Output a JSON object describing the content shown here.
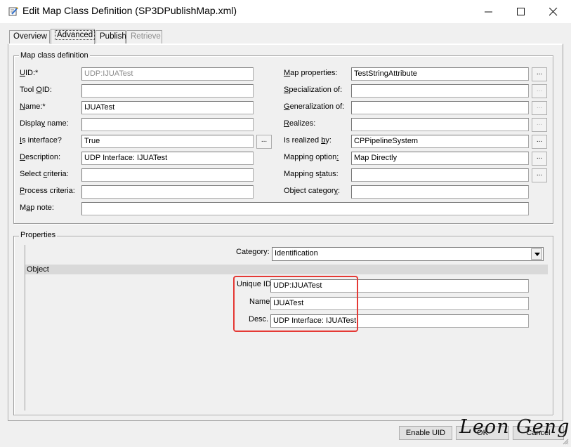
{
  "window": {
    "title": "Edit Map Class Definition (SP3DPublishMap.xml)",
    "minimize": "—",
    "maximize": "☐",
    "close": "✕"
  },
  "tabs": [
    {
      "label": "Overview",
      "state": "normal"
    },
    {
      "label": "Advanced",
      "state": "active"
    },
    {
      "label": "Publish",
      "state": "normal"
    },
    {
      "label": "Retrieve",
      "state": "disabled"
    }
  ],
  "map_class": {
    "group_title": "Map class definition",
    "uid": {
      "label": "UID:*",
      "value": "UDP:IJUATest"
    },
    "tool_oid": {
      "label": "Tool OID:",
      "value": ""
    },
    "name": {
      "label": "Name:*",
      "value": "IJUATest"
    },
    "display_name": {
      "label": "Display name:",
      "value": ""
    },
    "is_interface": {
      "label": "Is interface?",
      "value": "True"
    },
    "description": {
      "label": "Description:",
      "value": "UDP Interface: IJUATest"
    },
    "select_criteria": {
      "label": "Select criteria:",
      "value": ""
    },
    "process_criteria": {
      "label": "Process criteria:",
      "value": ""
    },
    "map_note": {
      "label": "Map note:",
      "value": ""
    },
    "map_properties": {
      "label": "Map properties:",
      "value": "TestStringAttribute"
    },
    "specialization_of": {
      "label": "Specialization of:",
      "value": ""
    },
    "generalization_of": {
      "label": "Generalization of:",
      "value": ""
    },
    "realizes": {
      "label": "Realizes:",
      "value": ""
    },
    "is_realized_by": {
      "label": "Is realized by:",
      "value": "CPPipelineSystem"
    },
    "mapping_option": {
      "label": "Mapping option:",
      "value": "Map Directly"
    },
    "mapping_status": {
      "label": "Mapping status:",
      "value": ""
    },
    "object_category": {
      "label": "Object category:",
      "value": ""
    },
    "ellipsis": "..."
  },
  "properties": {
    "group_title": "Properties",
    "category_label": "Category:",
    "category_value": "Identification",
    "object_band": "Object",
    "unique_id": {
      "label": "Unique ID",
      "value": "UDP:IJUATest"
    },
    "name": {
      "label": "Name",
      "value": "IJUATest"
    },
    "desc": {
      "label": "Desc.",
      "value": "UDP Interface: IJUATest"
    }
  },
  "buttons": {
    "enable_uid": "Enable UID",
    "ok": "OK",
    "cancel": "Cancel"
  },
  "signature": "Leon Geng",
  "colors": {
    "highlight": "#e53935"
  }
}
